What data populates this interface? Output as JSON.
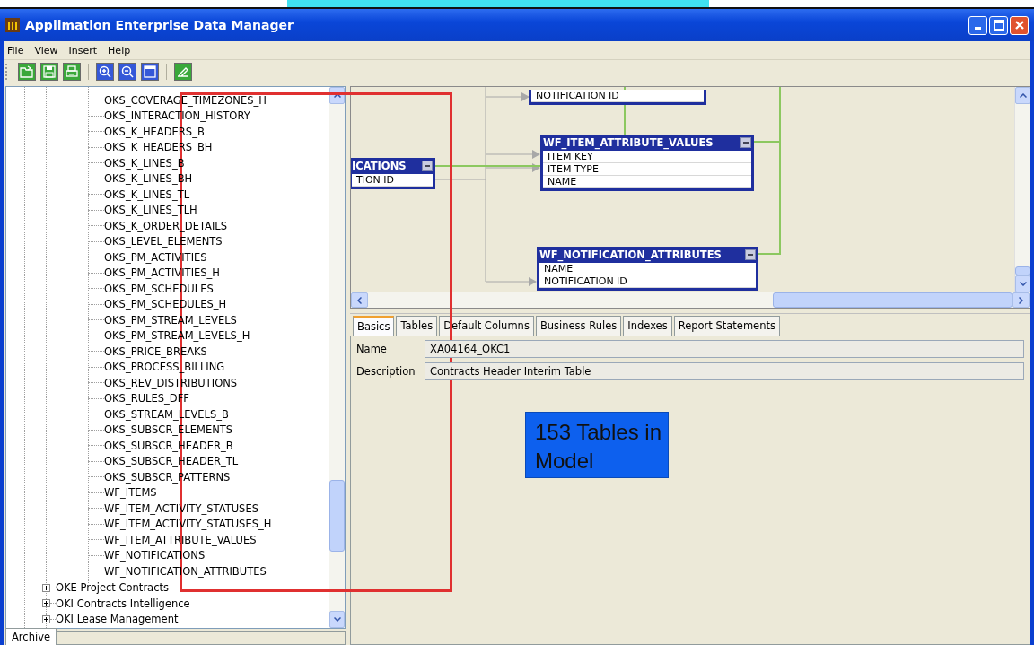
{
  "window": {
    "title": "Applimation Enterprise Data Manager"
  },
  "menu": [
    "File",
    "View",
    "Insert",
    "Help"
  ],
  "toolbar": [
    {
      "kind": "open"
    },
    {
      "kind": "save"
    },
    {
      "kind": "print"
    },
    {
      "kind": "zoom-in"
    },
    {
      "kind": "zoom-out"
    },
    {
      "kind": "window"
    },
    {
      "kind": "edit"
    }
  ],
  "tree": {
    "items": [
      "OKS_COVERAGE_TIMEZONES_H",
      "OKS_INTERACTION_HISTORY",
      "OKS_K_HEADERS_B",
      "OKS_K_HEADERS_BH",
      "OKS_K_LINES_B",
      "OKS_K_LINES_BH",
      "OKS_K_LINES_TL",
      "OKS_K_LINES_TLH",
      "OKS_K_ORDER_DETAILS",
      "OKS_LEVEL_ELEMENTS",
      "OKS_PM_ACTIVITIES",
      "OKS_PM_ACTIVITIES_H",
      "OKS_PM_SCHEDULES",
      "OKS_PM_SCHEDULES_H",
      "OKS_PM_STREAM_LEVELS",
      "OKS_PM_STREAM_LEVELS_H",
      "OKS_PRICE_BREAKS",
      "OKS_PROCESS_BILLING",
      "OKS_REV_DISTRIBUTIONS",
      "OKS_RULES_DFF",
      "OKS_STREAM_LEVELS_B",
      "OKS_SUBSCR_ELEMENTS",
      "OKS_SUBSCR_HEADER_B",
      "OKS_SUBSCR_HEADER_TL",
      "OKS_SUBSCR_PATTERNS",
      "WF_ITEMS",
      "WF_ITEM_ACTIVITY_STATUSES",
      "WF_ITEM_ACTIVITY_STATUSES_H",
      "WF_ITEM_ATTRIBUTE_VALUES",
      "WF_NOTIFICATIONS",
      "WF_NOTIFICATION_ATTRIBUTES"
    ],
    "groups": [
      {
        "label": "OKE Project Contracts",
        "expanded": false
      },
      {
        "label": "OKI Contracts Intelligence",
        "expanded": false
      },
      {
        "label": "OKI Lease Management",
        "expanded": false
      }
    ]
  },
  "bottom_tabs": [
    {
      "label": "Archive",
      "selected": true
    }
  ],
  "diagram": {
    "entities": [
      {
        "fields": [
          "NOTIFICATION ID"
        ]
      },
      {
        "title": "ICATIONS",
        "fields": [
          "TION ID"
        ]
      },
      {
        "title": "WF_ITEM_ATTRIBUTE_VALUES",
        "fields": [
          "ITEM KEY",
          "ITEM TYPE",
          "NAME"
        ]
      },
      {
        "title": "WF_NOTIFICATION_ATTRIBUTES",
        "fields": [
          "NAME",
          "NOTIFICATION ID"
        ]
      }
    ]
  },
  "tabs": [
    {
      "label": "Basics",
      "selected": true
    },
    {
      "label": "Tables",
      "selected": false
    },
    {
      "label": "Default Columns",
      "selected": false
    },
    {
      "label": "Business Rules",
      "selected": false
    },
    {
      "label": "Indexes",
      "selected": false
    },
    {
      "label": "Report Statements",
      "selected": false
    }
  ],
  "form": [
    {
      "label": "Name",
      "value": "XA04164_OKC1"
    },
    {
      "label": "Description",
      "value": "Contracts Header Interim Table"
    }
  ],
  "note": "153 Tables in Model"
}
